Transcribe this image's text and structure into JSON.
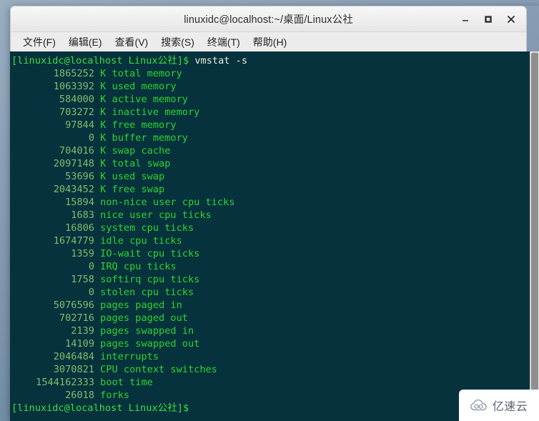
{
  "window": {
    "title": "linuxidc@localhost:~/桌面/Linux公社",
    "controls": {
      "minimize": "minimize",
      "maximize": "maximize",
      "close": "close"
    }
  },
  "menubar": {
    "items": [
      {
        "label": "文件(F)",
        "name": "menu-file"
      },
      {
        "label": "编辑(E)",
        "name": "menu-edit"
      },
      {
        "label": "查看(V)",
        "name": "menu-view"
      },
      {
        "label": "搜索(S)",
        "name": "menu-search"
      },
      {
        "label": "终端(T)",
        "name": "menu-terminal"
      },
      {
        "label": "帮助(H)",
        "name": "menu-help"
      }
    ]
  },
  "terminal": {
    "prompt_prefix": "[linuxidc@localhost Linux公社]$",
    "command": "vmstat -s",
    "lines": [
      {
        "value": "1865252",
        "label": "K total memory"
      },
      {
        "value": "1063392",
        "label": "K used memory"
      },
      {
        "value": "584000",
        "label": "K active memory"
      },
      {
        "value": "703272",
        "label": "K inactive memory"
      },
      {
        "value": "97844",
        "label": "K free memory"
      },
      {
        "value": "0",
        "label": "K buffer memory"
      },
      {
        "value": "704016",
        "label": "K swap cache"
      },
      {
        "value": "2097148",
        "label": "K total swap"
      },
      {
        "value": "53696",
        "label": "K used swap"
      },
      {
        "value": "2043452",
        "label": "K free swap"
      },
      {
        "value": "15894",
        "label": "non-nice user cpu ticks"
      },
      {
        "value": "1683",
        "label": "nice user cpu ticks"
      },
      {
        "value": "16806",
        "label": "system cpu ticks"
      },
      {
        "value": "1674779",
        "label": "idle cpu ticks"
      },
      {
        "value": "1359",
        "label": "IO-wait cpu ticks"
      },
      {
        "value": "0",
        "label": "IRQ cpu ticks"
      },
      {
        "value": "1758",
        "label": "softirq cpu ticks"
      },
      {
        "value": "0",
        "label": "stolen cpu ticks"
      },
      {
        "value": "5076596",
        "label": "pages paged in"
      },
      {
        "value": "702716",
        "label": "pages paged out"
      },
      {
        "value": "2139",
        "label": "pages swapped in"
      },
      {
        "value": "14109",
        "label": "pages swapped out"
      },
      {
        "value": "2046484",
        "label": "interrupts"
      },
      {
        "value": "3070821",
        "label": "CPU context switches"
      },
      {
        "value": "1544162333",
        "label": "boot time"
      },
      {
        "value": "26018",
        "label": "forks"
      }
    ],
    "final_prompt": "[linuxidc@localhost Linux公社]$"
  },
  "watermark": {
    "text": "亿速云",
    "icon": "cloud-icon"
  },
  "colors": {
    "terminal_bg": "#05323d",
    "number_green": "#7dbf6a",
    "label_green": "#2fd42f",
    "prompt_green": "#3ddf3d",
    "command_white": "#e8f0d8"
  }
}
